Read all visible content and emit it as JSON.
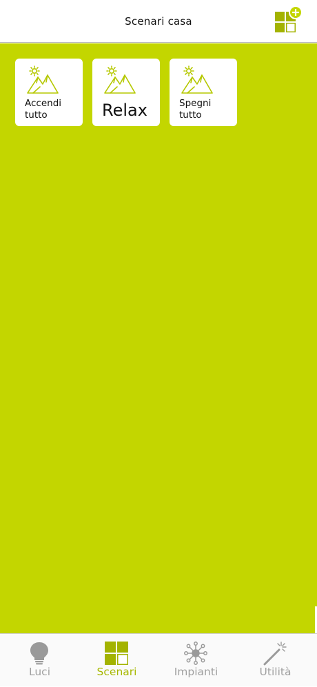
{
  "header": {
    "title": "Scenari casa",
    "add_icon": "add-scene-grid-icon"
  },
  "colors": {
    "accent": "#c3d600",
    "accent_dark": "#9fb300",
    "inactive": "#9a9a9a"
  },
  "scenes": [
    {
      "label": "Accendi\ntutto",
      "icon": "mountain-sun-icon"
    },
    {
      "label": "Relax",
      "icon": "mountain-sun-icon"
    },
    {
      "label": "Spegni\ntutto",
      "icon": "mountain-sun-icon"
    }
  ],
  "tabs": [
    {
      "label": "Luci",
      "icon": "lightbulb-icon",
      "active": false
    },
    {
      "label": "Scenari",
      "icon": "grid-icon",
      "active": true
    },
    {
      "label": "Impianti",
      "icon": "network-icon",
      "active": false
    },
    {
      "label": "Utilità",
      "icon": "magic-wand-icon",
      "active": false
    }
  ]
}
